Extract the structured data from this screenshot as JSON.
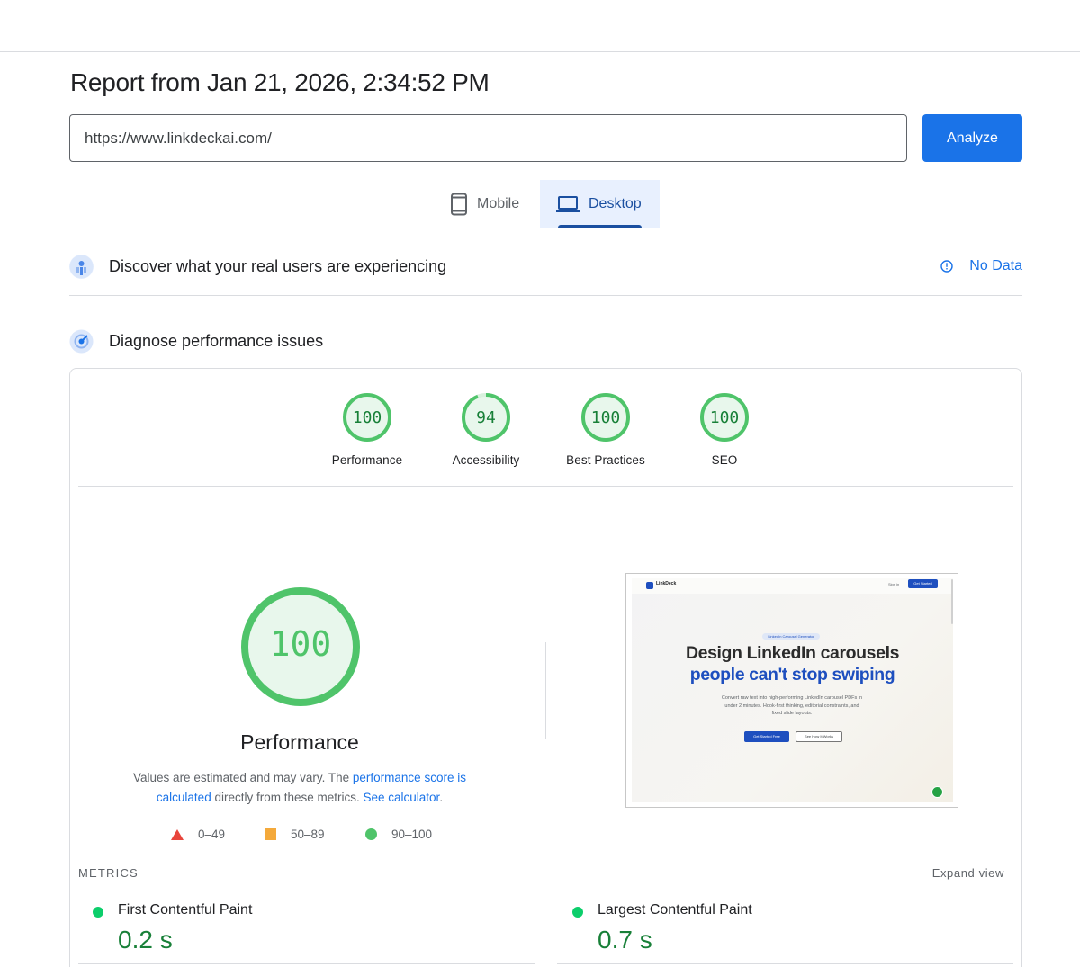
{
  "report": {
    "title": "Report from Jan 21, 2026, 2:34:52 PM"
  },
  "search": {
    "url": "https://www.linkdeckai.com/",
    "analyze_label": "Analyze"
  },
  "tabs": [
    {
      "label": "Mobile",
      "icon": "phone-icon",
      "selected": false
    },
    {
      "label": "Desktop",
      "icon": "laptop-icon",
      "selected": true
    }
  ],
  "real_users": {
    "title": "Discover what your real users are experiencing",
    "status": "No Data"
  },
  "diagnose": {
    "title": "Diagnose performance issues"
  },
  "scores": [
    {
      "label": "Performance",
      "value": "100"
    },
    {
      "label": "Accessibility",
      "value": "94"
    },
    {
      "label": "Best Practices",
      "value": "100"
    },
    {
      "label": "SEO",
      "value": "100"
    }
  ],
  "performance": {
    "score": "100",
    "label": "Performance",
    "note_prefix": "Values are estimated and may vary. The ",
    "note_link1": "performance score is calculated",
    "note_mid": " directly from these metrics. ",
    "note_link2": "See calculator",
    "note_suffix": "."
  },
  "legend": [
    {
      "range": "0–49",
      "shape": "triangle",
      "color": "#e8453c"
    },
    {
      "range": "50–89",
      "shape": "square",
      "color": "#f4a93b"
    },
    {
      "range": "90–100",
      "shape": "circle",
      "color": "#4fc46a"
    }
  ],
  "screenshot": {
    "brand": "LinkDeck",
    "signin": "Sign in",
    "get_started": "Get Started",
    "badge": "LinkedIn Carousel Generator",
    "headline1": "Design LinkedIn carousels",
    "headline2": "people can't stop swiping",
    "description": "Convert raw text into high-performing LinkedIn carousel PDFs in under 2 minutes. Hook-first thinking, editorial constraints, and fixed slide layouts.",
    "btn_primary": "Get Started Free",
    "btn_secondary": "See How It Works"
  },
  "metrics": {
    "header": "METRICS",
    "expand_label": "Expand view",
    "items": [
      {
        "name": "First Contentful Paint",
        "value": "0.2 s"
      },
      {
        "name": "Largest Contentful Paint",
        "value": "0.7 s"
      }
    ]
  },
  "colors": {
    "accent": "#1a73e8",
    "pass": "#0cce6b",
    "pass_text": "#188038"
  }
}
